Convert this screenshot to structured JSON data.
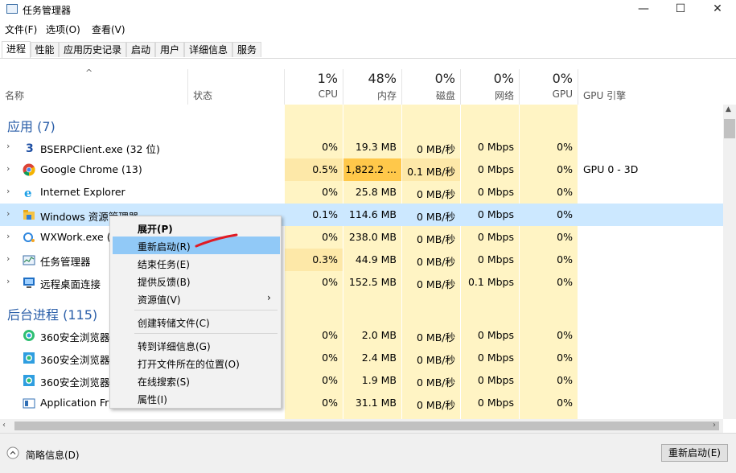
{
  "window": {
    "title": "任务管理器",
    "minimize": "—",
    "maximize": "☐",
    "close": "✕"
  },
  "menu": [
    "文件(F)",
    "选项(O)",
    "查看(V)"
  ],
  "tabs": [
    "进程",
    "性能",
    "应用历史记录",
    "启动",
    "用户",
    "详细信息",
    "服务"
  ],
  "header": {
    "name": "名称",
    "status": "状态",
    "cpu_pct": "1%",
    "cpu": "CPU",
    "mem_pct": "48%",
    "mem": "内存",
    "disk_pct": "0%",
    "disk": "磁盘",
    "net_pct": "0%",
    "net": "网络",
    "gpu_pct": "0%",
    "gpu": "GPU",
    "gpu_engine": "GPU 引擎"
  },
  "groups": {
    "apps": "应用 (7)",
    "background": "后台进程 (115)"
  },
  "apps": [
    {
      "name": "BSERPClient.exe (32 位)",
      "cpu": "0%",
      "mem": "19.3 MB",
      "disk": "0 MB/秒",
      "net": "0 Mbps",
      "gpu": "0%",
      "engine": "",
      "icon": "bserp-icon"
    },
    {
      "name": "Google Chrome (13)",
      "cpu": "0.5%",
      "mem": "1,822.2 ...",
      "disk": "0.1 MB/秒",
      "net": "0 Mbps",
      "gpu": "0%",
      "engine": "GPU 0 - 3D",
      "icon": "chrome-icon"
    },
    {
      "name": "Internet Explorer",
      "cpu": "0%",
      "mem": "25.8 MB",
      "disk": "0 MB/秒",
      "net": "0 Mbps",
      "gpu": "0%",
      "engine": "",
      "icon": "ie-icon"
    },
    {
      "name": "Windows 资源管理器",
      "cpu": "0.1%",
      "mem": "114.6 MB",
      "disk": "0 MB/秒",
      "net": "0 Mbps",
      "gpu": "0%",
      "engine": "",
      "icon": "explorer-icon"
    },
    {
      "name": "WXWork.exe (",
      "cpu": "0%",
      "mem": "238.0 MB",
      "disk": "0 MB/秒",
      "net": "0 Mbps",
      "gpu": "0%",
      "engine": "",
      "icon": "wxwork-icon"
    },
    {
      "name": "任务管理器",
      "cpu": "0.3%",
      "mem": "44.9 MB",
      "disk": "0 MB/秒",
      "net": "0 Mbps",
      "gpu": "0%",
      "engine": "",
      "icon": "taskmgr-icon"
    },
    {
      "name": "远程桌面连接",
      "cpu": "0%",
      "mem": "152.5 MB",
      "disk": "0 MB/秒",
      "net": "0.1 Mbps",
      "gpu": "0%",
      "engine": "",
      "icon": "remote-desktop-icon"
    }
  ],
  "background": [
    {
      "name": "360安全浏览器",
      "cpu": "0%",
      "mem": "2.0 MB",
      "disk": "0 MB/秒",
      "net": "0 Mbps",
      "gpu": "0%"
    },
    {
      "name": "360安全浏览器",
      "cpu": "0%",
      "mem": "2.4 MB",
      "disk": "0 MB/秒",
      "net": "0 Mbps",
      "gpu": "0%"
    },
    {
      "name": "360安全浏览器",
      "cpu": "0%",
      "mem": "1.9 MB",
      "disk": "0 MB/秒",
      "net": "0 Mbps",
      "gpu": "0%"
    },
    {
      "name": "Application Fra",
      "cpu": "0%",
      "mem": "31.1 MB",
      "disk": "0 MB/秒",
      "net": "0 Mbps",
      "gpu": "0%"
    }
  ],
  "context_menu": {
    "expand": "展开(P)",
    "restart": "重新启动(R)",
    "end_task": "结束任务(E)",
    "feedback": "提供反馈(B)",
    "resource_values": "资源值(V)",
    "dump": "创建转储文件(C)",
    "details": "转到详细信息(G)",
    "open_location": "打开文件所在的位置(O)",
    "search_online": "在线搜索(S)",
    "properties": "属性(I)"
  },
  "footer": {
    "fewer_details": "简略信息(D)",
    "restart_button": "重新启动(E)"
  },
  "colors": {
    "accent": "#2a5ea8",
    "highlight": "#cce8ff",
    "band": "#fff4c4",
    "annotation": "#e01b24"
  }
}
